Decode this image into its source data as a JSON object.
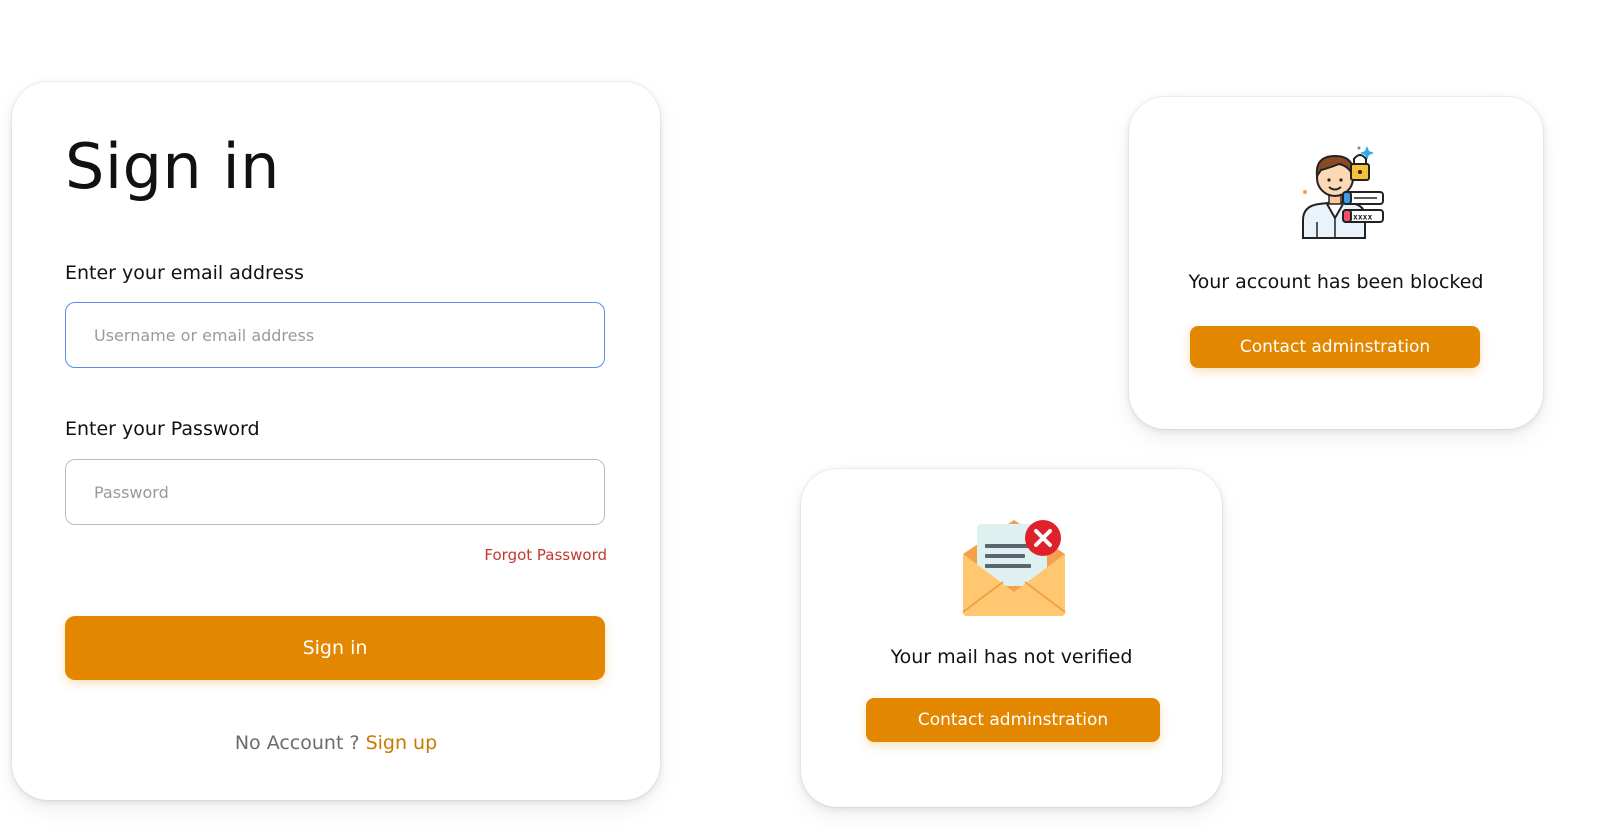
{
  "signin": {
    "title": "Sign in",
    "email_label": "Enter your email address",
    "email_placeholder": "Username or email address",
    "email_value": "",
    "password_label": "Enter your Password",
    "password_placeholder": "Password",
    "password_value": "",
    "forgot_label": "Forgot Password",
    "button_label": "Sign in",
    "no_account_text": "No Account ?",
    "signup_label": "Sign up"
  },
  "blocked": {
    "icon": "user-lock-icon",
    "message": "Your account has been blocked",
    "button_label": "Contact adminstration",
    "icon_password_mask": "xxxx"
  },
  "mail": {
    "icon": "mail-error-icon",
    "message": "Your mail has not verified",
    "button_label": "Contact adminstration"
  },
  "colors": {
    "accent": "#e38700",
    "link_red": "#c0392b",
    "focus_blue": "#5b8def",
    "signup_link": "#c77a00"
  }
}
